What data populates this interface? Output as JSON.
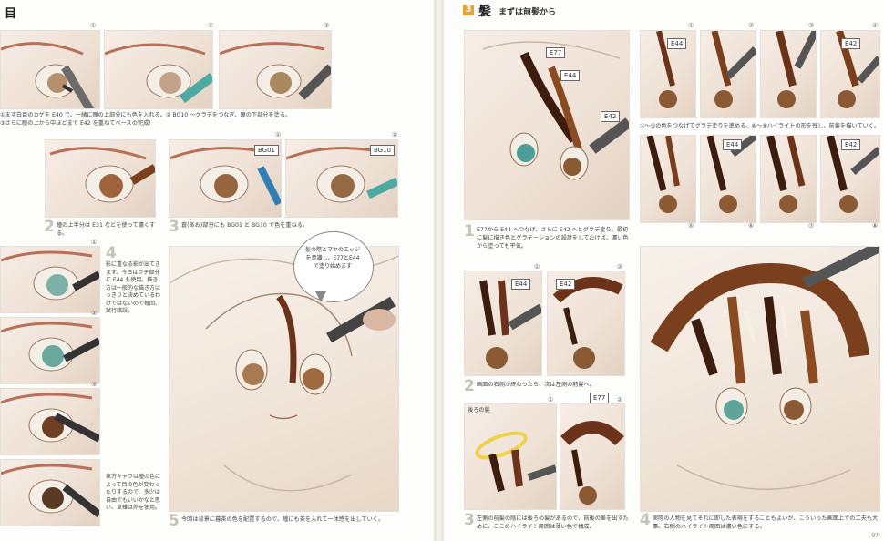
{
  "colors": {
    "accent": "#e5a530",
    "marker_gray": "#6b6b6b",
    "marker_teal": "#4fa9a3",
    "marker_blue": "#2f7fb4",
    "hair_brown": "#7a3f1c",
    "highlight_yellow": "#f0d24a"
  },
  "left": {
    "title": "目",
    "captions": {
      "c1": "①まず白目のカゲを E40 で。一緒に瞳の上部分にも色を入れる。② BG10 〜グラデをつなぎ、瞳の下部分を塗る。",
      "c2": "③さらに瞳の上から中ほどまで E42 を重ねてベースの完成!",
      "step2": "瞳の上半分は E31 などを使って濃くする。",
      "step3": "蒼(あお)部分にも BG01 と BG10 で色を重ねる。",
      "step4": "影に重なる影が出てきます。今日はフチ部分に E44 も使用。描き方は一般的な描き方はっきりと決めているわけではないので毎回、試行錯誤。",
      "side_note": "東方キャラは瞳の色によって目の色が変わったりするので、多少は自由でもいいかなと思い、草薙は外を使用。",
      "step5": "今回は背景に暮茶の色を配置するので、瞳にも茶を入れて一体感を出していく。"
    },
    "numbers": {
      "n1": "①",
      "n2": "②",
      "n3": "③"
    },
    "steps": {
      "s2": "2",
      "s3": "3",
      "s4": "4",
      "s5": "5"
    },
    "tags": {
      "bg01": "BG01",
      "bg10": "BG10"
    },
    "bubble": "髪の際とマヤのエッジを意識し、E77とE44で塗り始めます"
  },
  "right": {
    "section_num": "3",
    "section_kanji": "髪",
    "section_sub": "まずは前髪から",
    "numbers": {
      "n1": "①",
      "n2": "②",
      "n3": "③",
      "n4": "④",
      "n5": "⑤",
      "n6": "⑥",
      "n7": "⑦",
      "n8": "⑧"
    },
    "steps": {
      "s1": "1",
      "s2": "2",
      "s3": "3",
      "s4": "4"
    },
    "tags": {
      "e77": "E77",
      "e44": "E44",
      "e42": "E42"
    },
    "back_hair_label": "後ろの髪",
    "captions": {
      "step1": "E77から E44 へつなげ、さらに E42 へとグラデ塗り。最初に髪に描き色とグラデーションの設計をしておけば、濃い色から塗っても平気。",
      "mid": "①〜⑤の色をつなげてグラデ塗りを進める。⑥〜⑧ハイライトの形を残し、前髪を描いていく。",
      "step2": "画面の右側が終わったら、次は左側の前髪へ。",
      "step3": "左側の前髪の陰には後ろの髪があるので、前後の差を出すために、ここのハイライト周囲は薄い色で構成。",
      "step4": "実際の人物を見てそれに即した表現をすることもよいが、こういった画面上での工夫も大事。右側のハイライト周囲は濃い色にする。"
    },
    "page_no": "97"
  }
}
